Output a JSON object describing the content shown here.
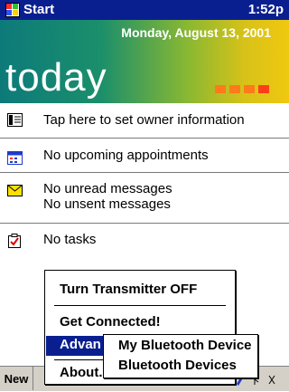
{
  "titlebar": {
    "title": "Start",
    "time": "1:52p"
  },
  "banner": {
    "date": "Monday, August 13, 2001",
    "today": "today",
    "square_colors": [
      "#ff7a1a",
      "#ff7a1a",
      "#ff7a1a",
      "#ff3d1a"
    ]
  },
  "items": {
    "owner": {
      "text": "Tap here to set owner information",
      "icon": "owner-card-icon"
    },
    "appointments": {
      "text": "No upcoming appointments",
      "icon": "calendar-icon"
    },
    "messages": {
      "line1": "No unread messages",
      "line2": "No unsent messages",
      "icon": "envelope-icon"
    },
    "tasks": {
      "text": "No tasks",
      "icon": "task-check-icon"
    }
  },
  "menu": {
    "transmitter": "Turn Transmitter OFF",
    "connected": "Get Connected!",
    "advanced": "Advan",
    "about": "About..."
  },
  "submenu": {
    "device": "My Bluetooth Device",
    "devices": "Bluetooth Devices"
  },
  "bottombar": {
    "new_label": "New"
  },
  "colors": {
    "titlebar": "#0a1f8f",
    "highlight": "#0a1f8f"
  }
}
